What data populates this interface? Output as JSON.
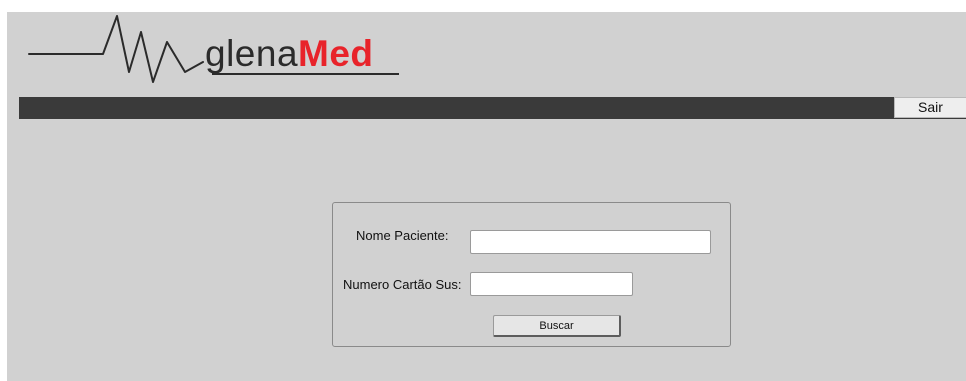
{
  "header": {
    "logo_text_part1": "glena",
    "logo_text_part2": "Med",
    "logout_label": "Sair"
  },
  "search": {
    "name_label": "Nome Paciente:",
    "name_value": "",
    "card_label": "Numero Cartão Sus:",
    "card_value": "",
    "submit_label": "Buscar"
  },
  "colors": {
    "page_background": "#d1d1d1",
    "navbar": "#3a3a3a",
    "logo_accent": "#e8232a",
    "logo_text": "#2b2b2b"
  }
}
